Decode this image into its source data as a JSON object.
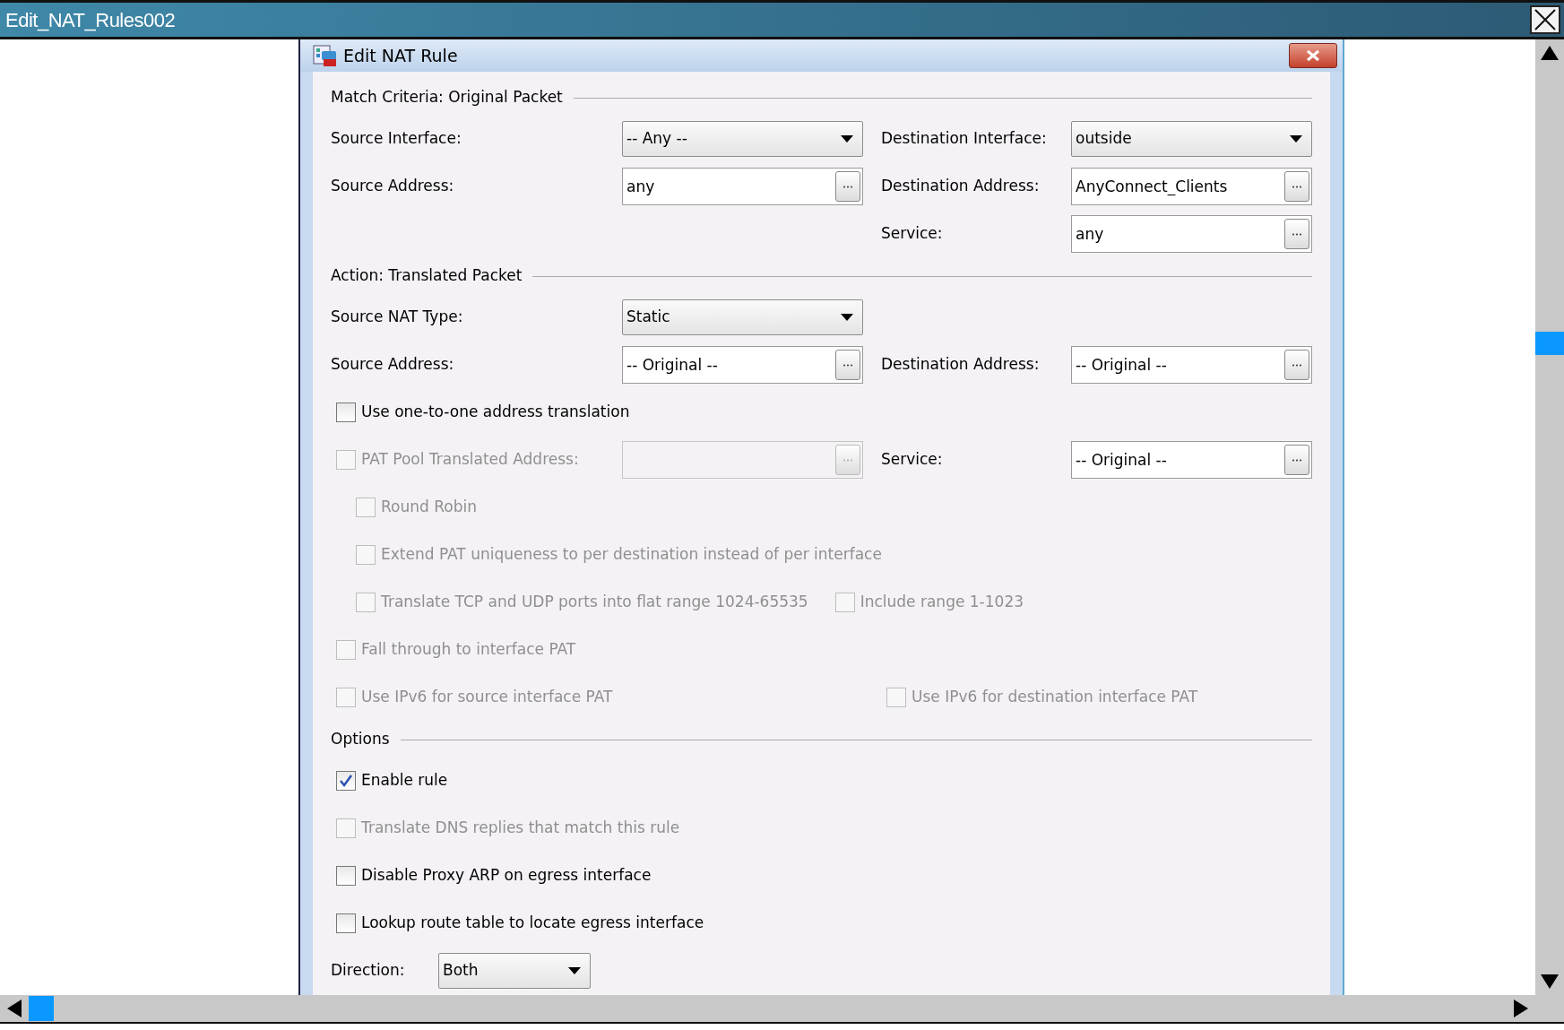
{
  "window": {
    "title": "Edit_NAT_Rules002"
  },
  "dialog": {
    "title": "Edit NAT Rule",
    "sections": [
      {
        "title": "Match Criteria: Original Packet",
        "rows": [
          {
            "left": {
              "kind": "select",
              "label": "Source Interface:",
              "value": "-- Any --"
            },
            "right": {
              "kind": "select",
              "label": "Destination Interface:",
              "value": "outside"
            }
          },
          {
            "left": {
              "kind": "browse",
              "label": "Source Address:",
              "value": "any"
            },
            "right": {
              "kind": "browse",
              "label": "Destination Address:",
              "value": "AnyConnect_Clients"
            }
          },
          {
            "right": {
              "kind": "browse",
              "label": "Service:",
              "value": "any"
            }
          }
        ]
      },
      {
        "title": "Action: Translated Packet",
        "rows": [
          {
            "left": {
              "kind": "select",
              "label": "Source NAT Type:",
              "value": "Static"
            }
          },
          {
            "left": {
              "kind": "browse",
              "label": "Source Address:",
              "value": "-- Original --"
            },
            "right": {
              "kind": "browse",
              "label": "Destination Address:",
              "value": "-- Original --"
            }
          },
          {
            "left": {
              "kind": "checkbox",
              "label": "Use one-to-one address translation",
              "checked": false,
              "disabled": false
            }
          },
          {
            "left": {
              "kind": "checkbox-browse",
              "label": "PAT Pool Translated Address:",
              "checked": false,
              "disabled": true
            },
            "right": {
              "kind": "browse",
              "label": "Service:",
              "value": "-- Original --"
            },
            "children": [
              {
                "items": [
                  {
                    "kind": "checkbox",
                    "label": "Round Robin",
                    "checked": false,
                    "disabled": true
                  }
                ]
              },
              {
                "items": [
                  {
                    "kind": "checkbox",
                    "label": "Extend PAT uniqueness to per destination instead of per interface",
                    "checked": false,
                    "disabled": true
                  }
                ]
              },
              {
                "items": [
                  {
                    "kind": "checkbox",
                    "label": "Translate TCP and UDP ports into flat range 1024-65535",
                    "checked": false,
                    "disabled": true
                  },
                  {
                    "kind": "checkbox",
                    "label": "Include range 1-1023",
                    "checked": false,
                    "disabled": true
                  }
                ]
              }
            ]
          },
          {
            "left": {
              "kind": "checkbox",
              "label": "Fall through to interface PAT",
              "checked": false,
              "disabled": true
            }
          },
          {
            "left": {
              "kind": "checkbox",
              "label": "Use IPv6 for source interface PAT",
              "checked": false,
              "disabled": true
            },
            "right": {
              "kind": "checkbox",
              "label": "Use IPv6 for destination interface PAT",
              "checked": false,
              "disabled": true
            }
          }
        ]
      },
      {
        "title": "Options",
        "rows": [
          {
            "left": {
              "kind": "checkbox",
              "label": "Enable rule",
              "checked": true,
              "disabled": false
            }
          },
          {
            "left": {
              "kind": "checkbox",
              "label": "Translate DNS replies that match this rule",
              "checked": false,
              "disabled": true
            }
          },
          {
            "left": {
              "kind": "checkbox",
              "label": "Disable Proxy ARP on egress interface",
              "checked": false,
              "disabled": false
            }
          },
          {
            "left": {
              "kind": "checkbox",
              "label": "Lookup route table to locate egress interface",
              "checked": false,
              "disabled": false
            }
          },
          {
            "left": {
              "kind": "small-select",
              "label": "Direction:",
              "value": "Both"
            }
          }
        ]
      }
    ]
  }
}
